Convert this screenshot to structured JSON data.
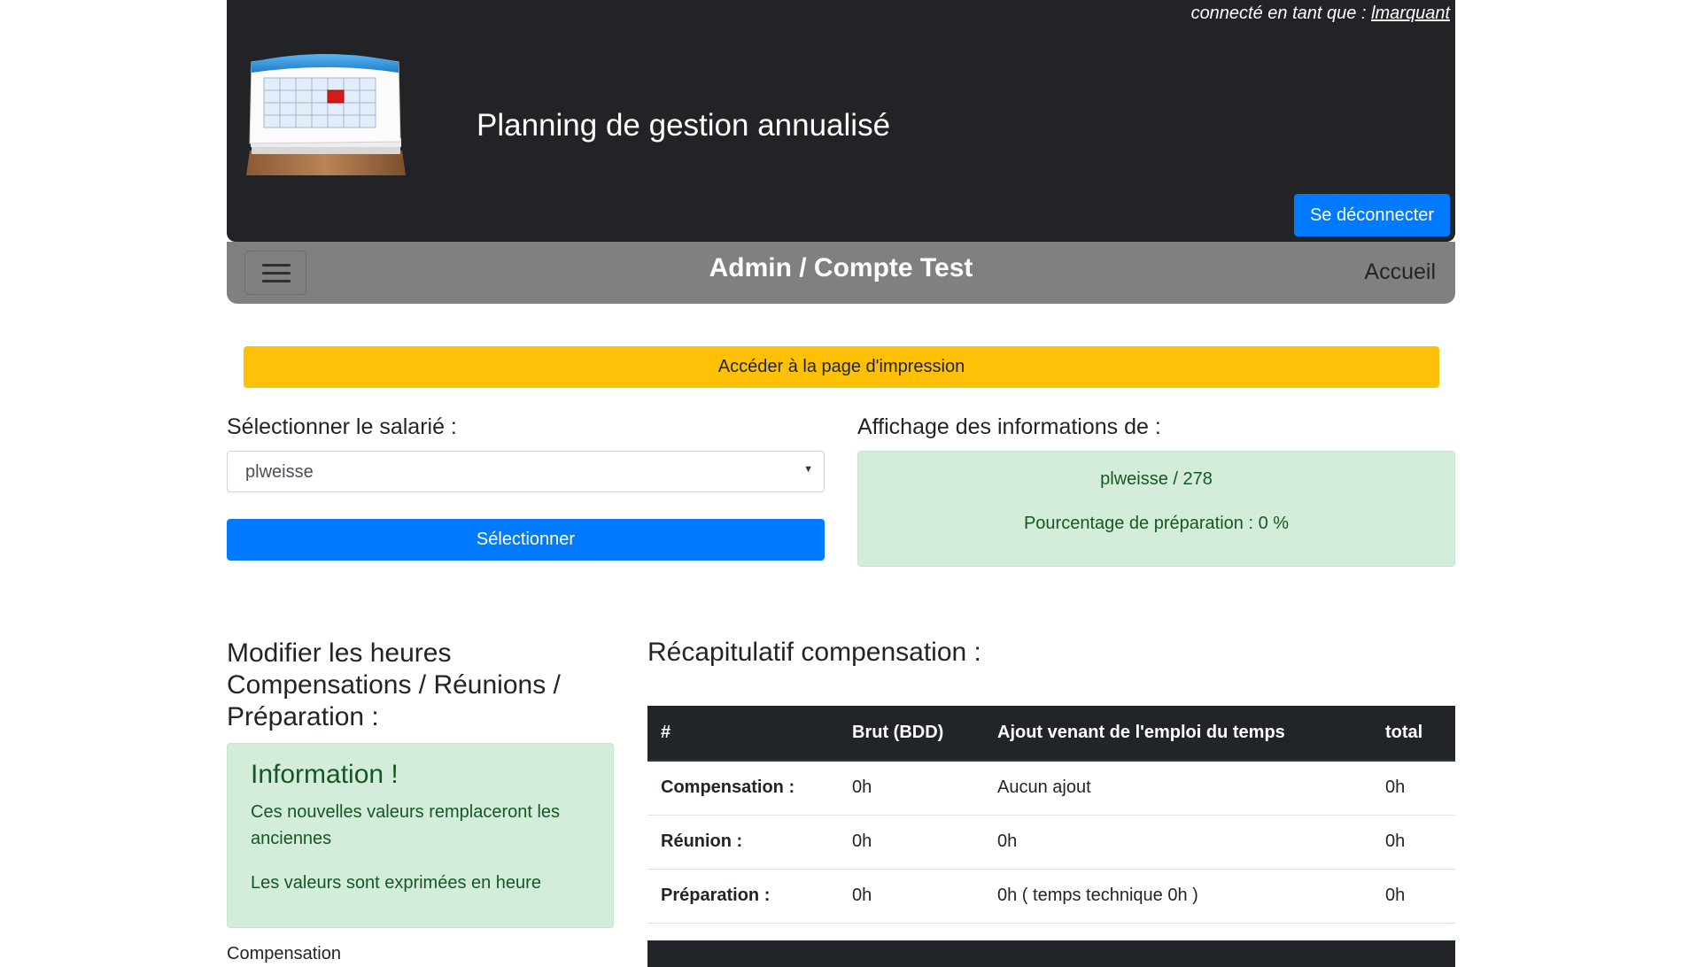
{
  "header": {
    "connected_prefix": "connecté en tant que :",
    "username": "lmarquant",
    "app_title": "Planning de gestion annualisé",
    "logout_label": "Se déconnecter",
    "logo_icon": "calendar-icon"
  },
  "nav": {
    "title": "Admin / Compte Test",
    "home_label": "Accueil",
    "menu_icon": "hamburger-menu-icon"
  },
  "print_button": "Accéder à la page d'impression",
  "select": {
    "label": "Sélectionner le salarié :",
    "value": "plweisse",
    "button": "Sélectionner"
  },
  "info": {
    "label": "Affichage des informations de :",
    "line1": "plweisse / 278",
    "line2": "Pourcentage de préparation : 0 %"
  },
  "modify": {
    "title": "Modifier les heures Compensations / Réunions / Préparation :",
    "alert_title": "Information !",
    "alert_p1": "Ces nouvelles valeurs remplaceront les anciennes",
    "alert_p2": "Les valeurs sont exprimées en heure",
    "next_label": "Compensation"
  },
  "recap": {
    "title": "Récapitulatif compensation :",
    "headers": [
      "#",
      "Brut (BDD)",
      "Ajout venant de l'emploi du temps",
      "total"
    ],
    "rows": [
      [
        "Compensation :",
        "0h",
        "Aucun ajout",
        "0h"
      ],
      [
        "Réunion :",
        "0h",
        "0h",
        "0h"
      ],
      [
        "Préparation :",
        "0h",
        "0h ( temps technique 0h )",
        "0h"
      ]
    ]
  },
  "colors": {
    "header_bg": "#212327",
    "nav_bg": "#808080",
    "primary": "#007bff",
    "warning": "#ffc107",
    "success_bg": "#d4edda",
    "success_text": "#155724"
  }
}
